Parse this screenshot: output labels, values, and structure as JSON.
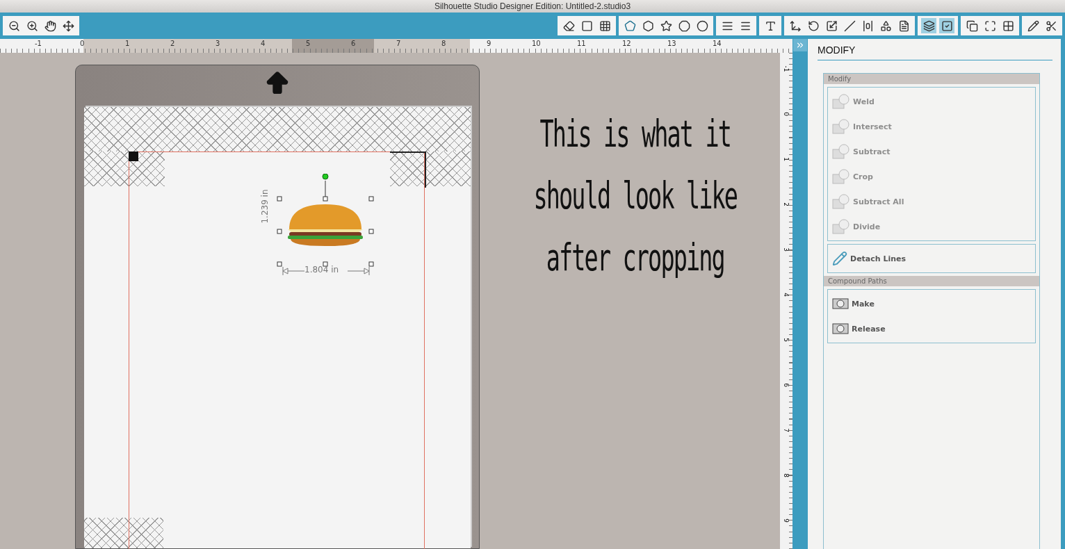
{
  "window": {
    "title": "Silhouette Studio Designer Edition: Untitled-2.studio3"
  },
  "toolbar_left": [
    {
      "selected": false
    },
    {
      "selected": false
    },
    {
      "selected": false
    },
    {
      "selected": false
    }
  ],
  "toolbar_groups": [
    [
      {
        "selected": false
      },
      {
        "selected": false
      },
      {
        "selected": false
      }
    ],
    [
      {
        "selected": false
      },
      {
        "selected": false
      },
      {
        "selected": false
      },
      {
        "selected": false
      },
      {
        "selected": false
      }
    ],
    [
      {
        "selected": false
      },
      {
        "selected": false
      }
    ],
    [
      {
        "selected": false
      }
    ],
    [
      {
        "selected": false
      },
      {
        "selected": false
      },
      {
        "selected": false
      },
      {
        "selected": false
      },
      {
        "selected": false
      },
      {
        "selected": false
      },
      {
        "selected": false
      }
    ],
    [
      {
        "selected": true
      },
      {
        "selected": true
      }
    ],
    [
      {
        "selected": false
      },
      {
        "selected": false
      },
      {
        "selected": false
      }
    ],
    [
      {
        "selected": false
      },
      {
        "selected": false
      }
    ]
  ],
  "ruler_h": [
    "-1",
    "0",
    "1",
    "2",
    "3",
    "4",
    "5",
    "6",
    "7",
    "8",
    "9",
    "10",
    "11",
    "12",
    "13",
    "14"
  ],
  "ruler_v": [
    "-1",
    "0",
    "1",
    "2",
    "3",
    "4",
    "5",
    "6",
    "7",
    "8",
    "9"
  ],
  "canvas": {
    "object": {
      "height": "1.239 in",
      "width": "1.804 in"
    },
    "note": "This is what it should look like after cropping"
  },
  "panel": {
    "title": "MODIFY",
    "sections": [
      {
        "title": "Modify",
        "groups": [
          [
            {
              "label": "Weld",
              "disabled": true
            },
            {
              "label": "Intersect",
              "disabled": true
            },
            {
              "label": "Subtract",
              "disabled": true
            },
            {
              "label": "Crop",
              "disabled": true
            },
            {
              "label": "Subtract All",
              "disabled": true
            },
            {
              "label": "Divide",
              "disabled": true
            }
          ],
          [
            {
              "label": "Detach Lines",
              "disabled": false
            }
          ]
        ]
      },
      {
        "title": "Compound Paths",
        "groups": [
          [
            {
              "label": "Make",
              "disabled": false
            },
            {
              "label": "Release",
              "disabled": false
            }
          ]
        ]
      }
    ]
  }
}
